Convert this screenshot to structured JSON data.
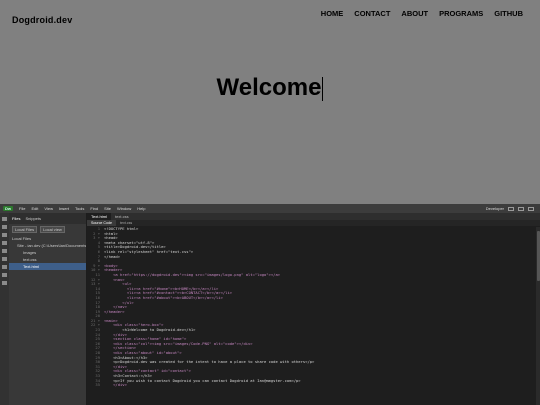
{
  "site": {
    "logo": "Dogdroid.dev",
    "nav": [
      "HOME",
      "CONTACT",
      "ABOUT",
      "PROGRAMS",
      "GITHUB"
    ],
    "headline": "Welcome"
  },
  "ide": {
    "app_badge": "Dw",
    "menus": [
      "File",
      "Edit",
      "View",
      "Insert",
      "Tools",
      "Find",
      "Site",
      "Window",
      "Help"
    ],
    "workspace": "Developer",
    "files_panel": {
      "tabs": [
        "Files",
        "Snippets"
      ],
      "toolbar_site": "Local Files",
      "toolbar_view": "Local view",
      "items": [
        {
          "label": "Local Files",
          "level": 0
        },
        {
          "label": "Site - ian.dev (C:\\Users\\Ian\\Documents\\...",
          "level": 1
        },
        {
          "label": "Images",
          "level": 2
        },
        {
          "label": "text.css",
          "level": 2
        },
        {
          "label": "Text.html",
          "level": 2,
          "selected": true
        }
      ]
    },
    "editor_tabs": [
      "Text.html",
      "text.css"
    ],
    "sub_tabs": [
      "Source Code",
      "text.css"
    ],
    "code_lines": [
      {
        "n": "1",
        "text": "<!DOCTYPE html>",
        "color": "#d8d8d8"
      },
      {
        "n": "2 ▾",
        "text": "<html>",
        "color": "#d8d8d8"
      },
      {
        "n": "3 ▾",
        "text": "<head>",
        "color": "#d8d8d8"
      },
      {
        "n": "4",
        "text": "<meta charset=\"utf-8\">",
        "color": "#d8d8d8"
      },
      {
        "n": "5",
        "text": "<title>Dogdroid.dev</title>",
        "color": "#d8d8d8"
      },
      {
        "n": "6",
        "text": "<link rel=\"stylesheet\" href=\"text.css\">",
        "color": "#d8d8d8"
      },
      {
        "n": "7",
        "text": "</head>",
        "color": "#d8d8d8"
      },
      {
        "n": "8",
        "text": "",
        "color": "#d8d8d8"
      },
      {
        "n": "9 ▾",
        "text": "<body>",
        "color": "#c586c0"
      },
      {
        "n": "10 ▾",
        "text": "<header>",
        "color": "#c586c0"
      },
      {
        "n": "11",
        "text": "    <a href=\"https://dogdroid.dev\"><img src=\"images/logo.png\" alt=\"logo\"></a>",
        "color": "#c586c0"
      },
      {
        "n": "12 ▾",
        "text": "    <nav>",
        "color": "#c586c0"
      },
      {
        "n": "13 ▾",
        "text": "        <ul>",
        "color": "#c586c0"
      },
      {
        "n": "14",
        "text": "          <li><a href=\"#home\"><b>HOME</b></a></li>",
        "color": "#c586c0"
      },
      {
        "n": "15",
        "text": "          <li><a href=\"#contact\"><b>CONTACT</b></a></li>",
        "color": "#c586c0"
      },
      {
        "n": "16",
        "text": "          <li><a href=\"#about\"><b>ABOUT</b></a></li>",
        "color": "#c586c0"
      },
      {
        "n": "17",
        "text": "        </ul>",
        "color": "#c586c0"
      },
      {
        "n": "18",
        "text": "    </nav>",
        "color": "#c586c0"
      },
      {
        "n": "19",
        "text": "</header>",
        "color": "#c586c0"
      },
      {
        "n": "20",
        "text": "",
        "color": "#d8d8d8"
      },
      {
        "n": "21 ▾",
        "text": "<main>",
        "color": "#c586c0"
      },
      {
        "n": "22 ▾",
        "text": "    <div class=\"hero-box\">",
        "color": "#c586c0"
      },
      {
        "n": "23",
        "text": "        <h1>Welcome to Dogdroid.dev</h1>",
        "color": "#d8d8d8"
      },
      {
        "n": "24",
        "text": "    </div>",
        "color": "#c586c0"
      },
      {
        "n": "25",
        "text": "    <section class=\"home\" id=\"home\">",
        "color": "#c586c0"
      },
      {
        "n": "26",
        "text": "    <div class=\"col\"><img src=\"images/Code.PNG\" alt=\"code\"></div>",
        "color": "#c586c0"
      },
      {
        "n": "27",
        "text": "    </section>",
        "color": "#c586c0"
      },
      {
        "n": "28",
        "text": "    <div class=\"about\" id=\"about\">",
        "color": "#c586c0"
      },
      {
        "n": "29",
        "text": "    <h3>About:</h3>",
        "color": "#d8d8d8"
      },
      {
        "n": "30",
        "text": "    <p>Dogdroid.dev was created for the intent to have a place to share code with others</p>",
        "color": "#d8d8d8"
      },
      {
        "n": "31",
        "text": "    </div>",
        "color": "#c586c0"
      },
      {
        "n": "32",
        "text": "    <div class=\"contact\" id=\"contact\">",
        "color": "#c586c0"
      },
      {
        "n": "33",
        "text": "    <h3>Contact:</h3>",
        "color": "#d8d8d8"
      },
      {
        "n": "34",
        "text": "    <p>If you wish to contact Dogdroid you can contact Dogdroid at Ian@mmgster.com</p>",
        "color": "#d8d8d8"
      },
      {
        "n": "35",
        "text": "    </div>",
        "color": "#c586c0"
      }
    ]
  }
}
